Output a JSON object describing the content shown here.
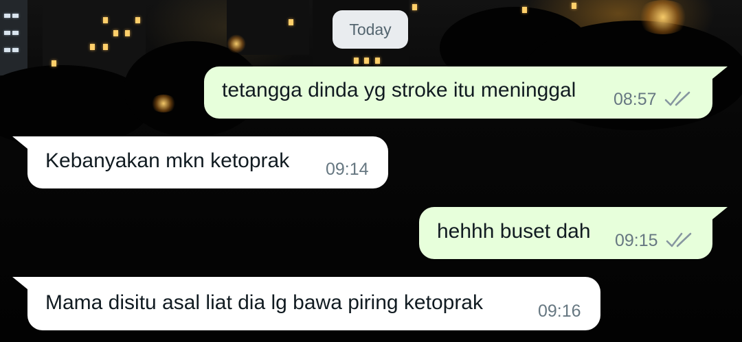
{
  "date_separator": "Today",
  "messages": [
    {
      "direction": "outgoing",
      "text": "tetangga dinda yg stroke itu meninggal",
      "time": "08:57",
      "status": "read-double-check"
    },
    {
      "direction": "incoming",
      "text": "Kebanyakan mkn ketoprak",
      "time": "09:14"
    },
    {
      "direction": "outgoing",
      "text": "hehhh buset dah",
      "time": "09:15",
      "status": "read-double-check"
    },
    {
      "direction": "incoming",
      "text": "Mama disitu asal liat dia lg bawa piring ketoprak",
      "time": "09:16"
    }
  ],
  "colors": {
    "outgoing_bubble": "#e7ffdb",
    "incoming_bubble": "#ffffff",
    "date_chip": "#e9ecef",
    "meta_text": "#667781",
    "message_text": "#111b21"
  },
  "icons": {
    "status": "double-check-icon"
  }
}
